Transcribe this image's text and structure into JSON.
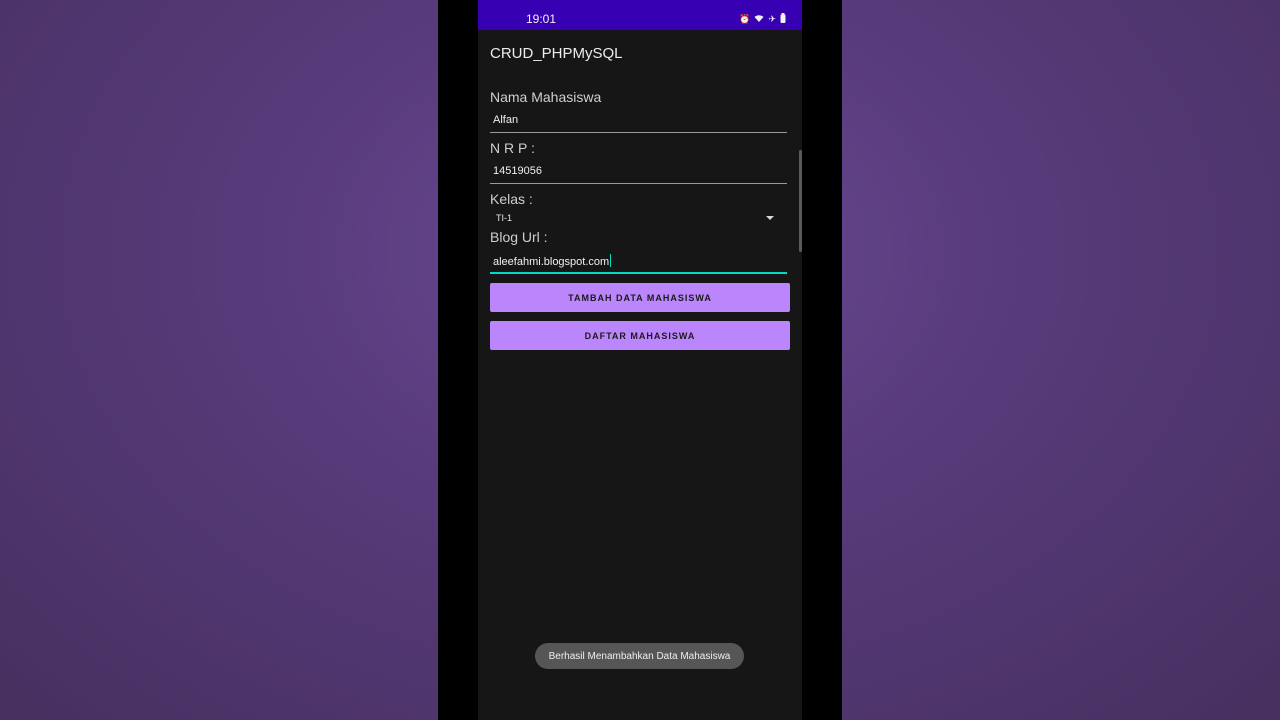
{
  "status_bar": {
    "time": "19:01",
    "icons": [
      "alarm-icon",
      "wifi-icon",
      "airplane-mode-icon",
      "battery-icon"
    ]
  },
  "app": {
    "title": "CRUD_PHPMySQL"
  },
  "form": {
    "nama_label": "Nama Mahasiswa",
    "nama_value": "Alfan",
    "nrp_label": "N R P :",
    "nrp_value": "14519056",
    "kelas_label": "Kelas :",
    "kelas_value": "TI-1",
    "blog_label": "Blog Url :",
    "blog_value": "aleefahmi.blogspot.com"
  },
  "buttons": {
    "add_label": "TAMBAH DATA MAHASISWA",
    "list_label": "DAFTAR MAHASISWA"
  },
  "toast": {
    "message": "Berhasil Menambahkan Data Mahasiswa"
  },
  "colors": {
    "status_bar": "#3700b3",
    "button": "#bb86fc",
    "focus_underline": "#03dac5",
    "background": "#161616"
  }
}
